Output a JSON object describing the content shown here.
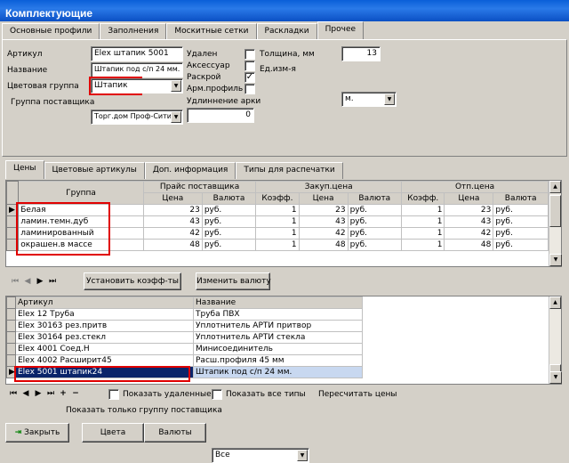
{
  "window": {
    "title": "Комплектующие"
  },
  "tabs": [
    "Основные профили",
    "Заполнения",
    "Москитные сетки",
    "Раскладки",
    "Прочее"
  ],
  "form": {
    "article_label": "Артикул",
    "article_value": "Elex штапик 5001",
    "name_label": "Название",
    "name_value": "Штапик под с/п 24 мм.",
    "color_group_label": "Цветовая группа",
    "color_group_value": "Штапик",
    "supplier_group_label": "Группа поставщика",
    "supplier_group_value": "Торг.дом Проф-Сити",
    "deleted_label": "Удален",
    "accessory_label": "Аксессуар",
    "cutting_label": "Раскрой",
    "arm_profile_label": "Арм.профиль",
    "arch_extension_label": "Удлиннение арки",
    "arch_extension_value": "0",
    "thickness_label": "Толщина, мм",
    "thickness_value": "13",
    "unit_label": "Ед.изм-я",
    "unit_value": "м.",
    "cutting_checked": "✓"
  },
  "subtabs": [
    "Цены",
    "Цветовые артикулы",
    "Доп. информация",
    "Типы для распечатки"
  ],
  "price_table": {
    "group_header": "Группа",
    "supplier_price_header": "Прайс поставщика",
    "purchase_price_header": "Закуп.цена",
    "sale_price_header": "Отп.цена",
    "price_col": "Цена",
    "currency_col": "Валюта",
    "coef_col": "Коэфф.",
    "rows": [
      {
        "group": "Белая",
        "price": "23",
        "cur": "руб.",
        "k1": "1",
        "p1": "23",
        "c1": "руб.",
        "k2": "1",
        "p2": "23",
        "c2": "руб."
      },
      {
        "group": "ламин.темн.дуб",
        "price": "43",
        "cur": "руб.",
        "k1": "1",
        "p1": "43",
        "c1": "руб.",
        "k2": "1",
        "p2": "43",
        "c2": "руб."
      },
      {
        "group": "ламинированный",
        "price": "42",
        "cur": "руб.",
        "k1": "1",
        "p1": "42",
        "c1": "руб.",
        "k2": "1",
        "p2": "42",
        "c2": "руб."
      },
      {
        "group": "окрашен.в массе",
        "price": "48",
        "cur": "руб.",
        "k1": "1",
        "p1": "48",
        "c1": "руб.",
        "k2": "1",
        "p2": "48",
        "c2": "руб."
      }
    ]
  },
  "buttons": {
    "set_coef": "Установить коэфф-ты",
    "change_currency": "Изменить валюту",
    "close": "Закрыть",
    "colors": "Цвета",
    "currencies": "Валюты"
  },
  "items_table": {
    "article_header": "Артикул",
    "name_header": "Название",
    "rows": [
      {
        "article": "Elex 12 Труба",
        "name": "Труба ПВХ"
      },
      {
        "article": "Elex 30163 рез.притв",
        "name": "Уплотнитель АРТИ притвор"
      },
      {
        "article": "Elex 30164 рез.стекл",
        "name": "Уплотнитель АРТИ стекла"
      },
      {
        "article": "Elex 4001 Соед.Н",
        "name": "Минисоединитель"
      },
      {
        "article": "Elex 4002 Расширит45",
        "name": "Расш.профиля 45 мм"
      },
      {
        "article": "Elex 5001 штапик24",
        "name": "Штапик под с/п 24 мм."
      }
    ]
  },
  "bottom": {
    "show_deleted": "Показать удаленные",
    "show_all_types": "Показать все типы",
    "recalc_prices": "Пересчитать цены",
    "show_only_supplier_group": "Показать только группу поставщика",
    "supplier_filter_value": "Все"
  },
  "icons": {
    "nav_first": "⏮",
    "nav_prev": "◀",
    "nav_next": "▶",
    "nav_last": "⏭",
    "nav_add": "+",
    "nav_delete": "−"
  }
}
